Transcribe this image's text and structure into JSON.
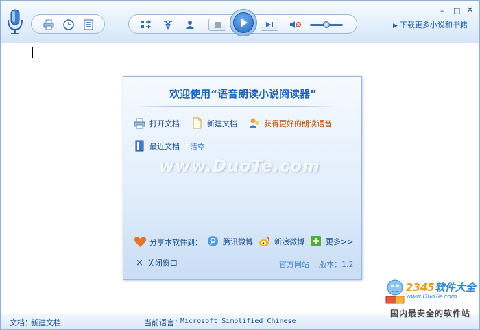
{
  "toolbar": {
    "icons": [
      "microphone-icon",
      "print-icon",
      "clock-icon",
      "list-icon",
      "switch-icon",
      "voice-icon",
      "user-icon",
      "stop-icon",
      "play-icon",
      "next-icon",
      "mute-icon"
    ],
    "volume_level": 0.5,
    "window_controls": {
      "minimize": "–",
      "maximize": "□",
      "close": "×"
    },
    "download_link": "下载更多小说和书籍"
  },
  "dialog": {
    "title": "欢迎使用“语音朗读小说阅读器”",
    "open_doc": "打开文档",
    "new_doc": "新建文档",
    "get_voices": "获得更好的朗读语音",
    "recent_docs": "最近文档",
    "clear": "清空",
    "watermark": "www.DuoTe.com",
    "share_label": "分享本软件到：",
    "share_tencent": "腾讯微博",
    "share_sina": "新浪微博",
    "share_more": "更多>>",
    "close": "关闭窗口",
    "official_site": "官方网站",
    "version": "版本：1.2"
  },
  "statusbar": {
    "doc_label": "文档：",
    "doc_name": "新建文档",
    "lang_label": "当前语言：",
    "lang_value": "Microsoft Simplified Chinese"
  },
  "logo": {
    "number": "2345",
    "brand": "软件大全",
    "url": "www.DuoTe.com",
    "slogan": "国内最安全的软件站"
  },
  "colors": {
    "accent": "#1f62b8",
    "orange": "#c25100",
    "border": "#8fb0d8"
  }
}
